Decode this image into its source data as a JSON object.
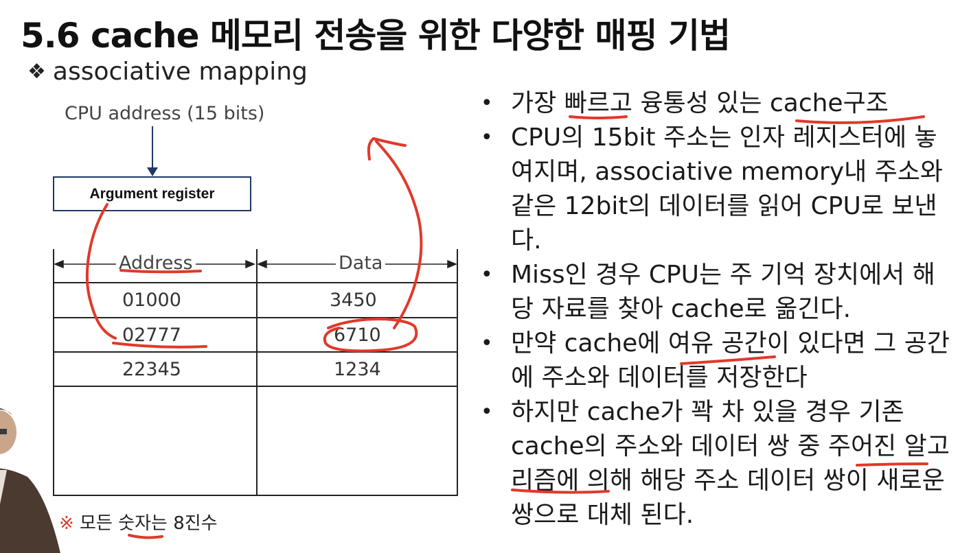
{
  "slide": {
    "title": "5.6 cache 메모리 전송을 위한 다양한 매핑 기법",
    "subtitle": "associative mapping",
    "subtitle_bullet": "❖"
  },
  "diagram": {
    "cpu_label": "CPU address (15 bits)",
    "register_label": "Argument register",
    "columns": [
      "Address",
      "Data"
    ],
    "rows": [
      {
        "address": "01000",
        "data": "3450"
      },
      {
        "address": "02777",
        "data": "6710"
      },
      {
        "address": "22345",
        "data": "1234"
      }
    ],
    "note_mark": "※",
    "note_text": " 모든 숫자는 8진수"
  },
  "bullets": [
    "가장 빠르고 융통성 있는 cache구조",
    "CPU의 15bit 주소는 인자 레지스터에 놓여지며, associative memory내 주소와 같은 12bit의 데이터를 읽어 CPU로 보낸다.",
    "Miss인 경우 CPU는 주 기억 장치에서 해당 자료를 찾아  cache로 옮긴다.",
    "만약 cache에 여유 공간이 있다면 그 공간에 주소와 데이터를 저장한다",
    "하지만 cache가 꽉 차 있을 경우 기존 cache의 주소와 데이터 쌍 중 주어진 알고리즘에 의해 해당 주소 데이터 쌍이 새로운 쌍으로 대체 된다."
  ],
  "bullet_symbol": "•",
  "annotation_color": "#e0392b"
}
